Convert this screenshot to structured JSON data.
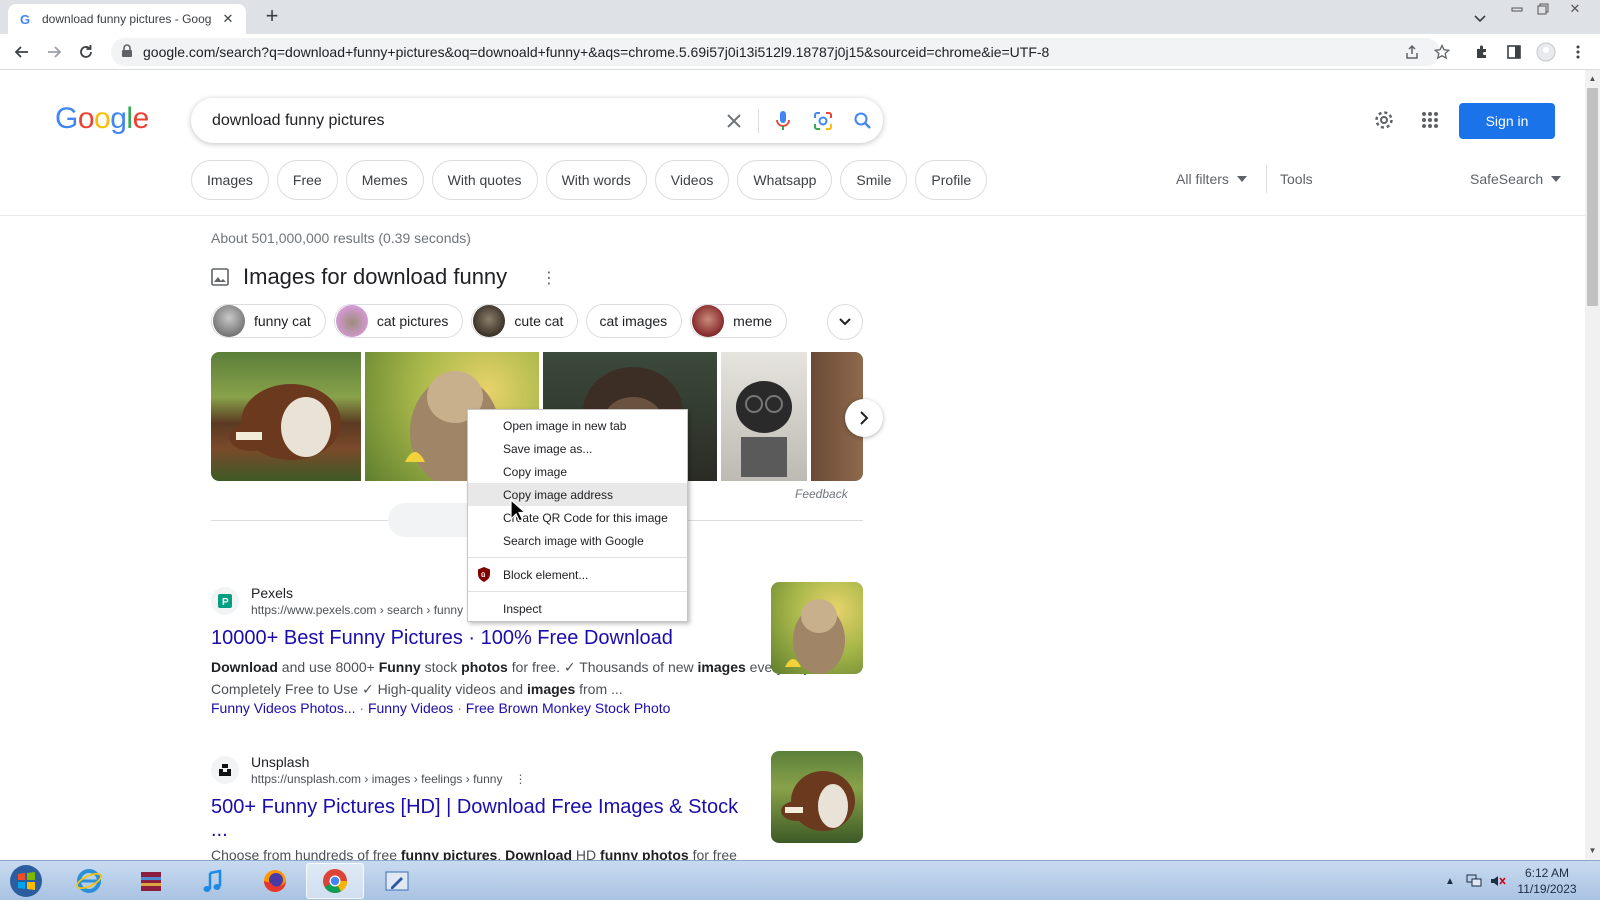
{
  "browser": {
    "tab_title": "download funny pictures - Goog",
    "url": "google.com/search?q=download+funny+pictures&oq=downoald+funny+&aqs=chrome.5.69i57j0i13i512l9.18787j0j15&sourceid=chrome&ie=UTF-8"
  },
  "search": {
    "query": "download funny pictures",
    "sign_in": "Sign in"
  },
  "filters": {
    "chips": [
      "Images",
      "Free",
      "Memes",
      "With quotes",
      "With words",
      "Videos",
      "Whatsapp",
      "Smile",
      "Profile"
    ],
    "all_filters": "All filters",
    "tools": "Tools",
    "safesearch": "SafeSearch"
  },
  "results": {
    "stats": "About 501,000,000 results (0.39 seconds)",
    "images_heading": "Images for download funny",
    "related_chips": [
      "funny cat",
      "cat pictures",
      "cute cat",
      "cat images",
      "meme"
    ],
    "feedback": "Feedback",
    "items": [
      {
        "site": "Pexels",
        "url": "https://www.pexels.com › search › funny",
        "title": "10000+ Best Funny Pictures · 100% Free Download",
        "snippet_html": "<b>Download</b> and use 8000+ <b>Funny</b> stock <b>photos</b> for free. ✓ Thousands of new <b>images</b> every day ✓ Completely Free to Use ✓ High-quality videos and <b>images</b> from ...",
        "sublinks": [
          "Funny Videos Photos...",
          "Funny Videos",
          "Free Brown Monkey Stock Photo"
        ]
      },
      {
        "site": "Unsplash",
        "url": "https://unsplash.com › images › feelings › funny",
        "title": "500+ Funny Pictures [HD] | Download Free Images & Stock",
        "title_cont": "...",
        "snippet_html": "Choose from hundreds of free <b>funny pictures</b>. <b>Download</b> HD <b>funny photos</b> for free"
      }
    ]
  },
  "context_menu": {
    "items": [
      "Open image in new tab",
      "Save image as...",
      "Copy image",
      "Copy image address",
      "Create QR Code for this image",
      "Search image with Google"
    ],
    "block": "Block element...",
    "inspect": "Inspect"
  },
  "taskbar": {
    "time": "6:12 AM",
    "date": "11/19/2023"
  },
  "colors": {
    "link": "#1a0dab",
    "accent": "#1a73e8"
  }
}
